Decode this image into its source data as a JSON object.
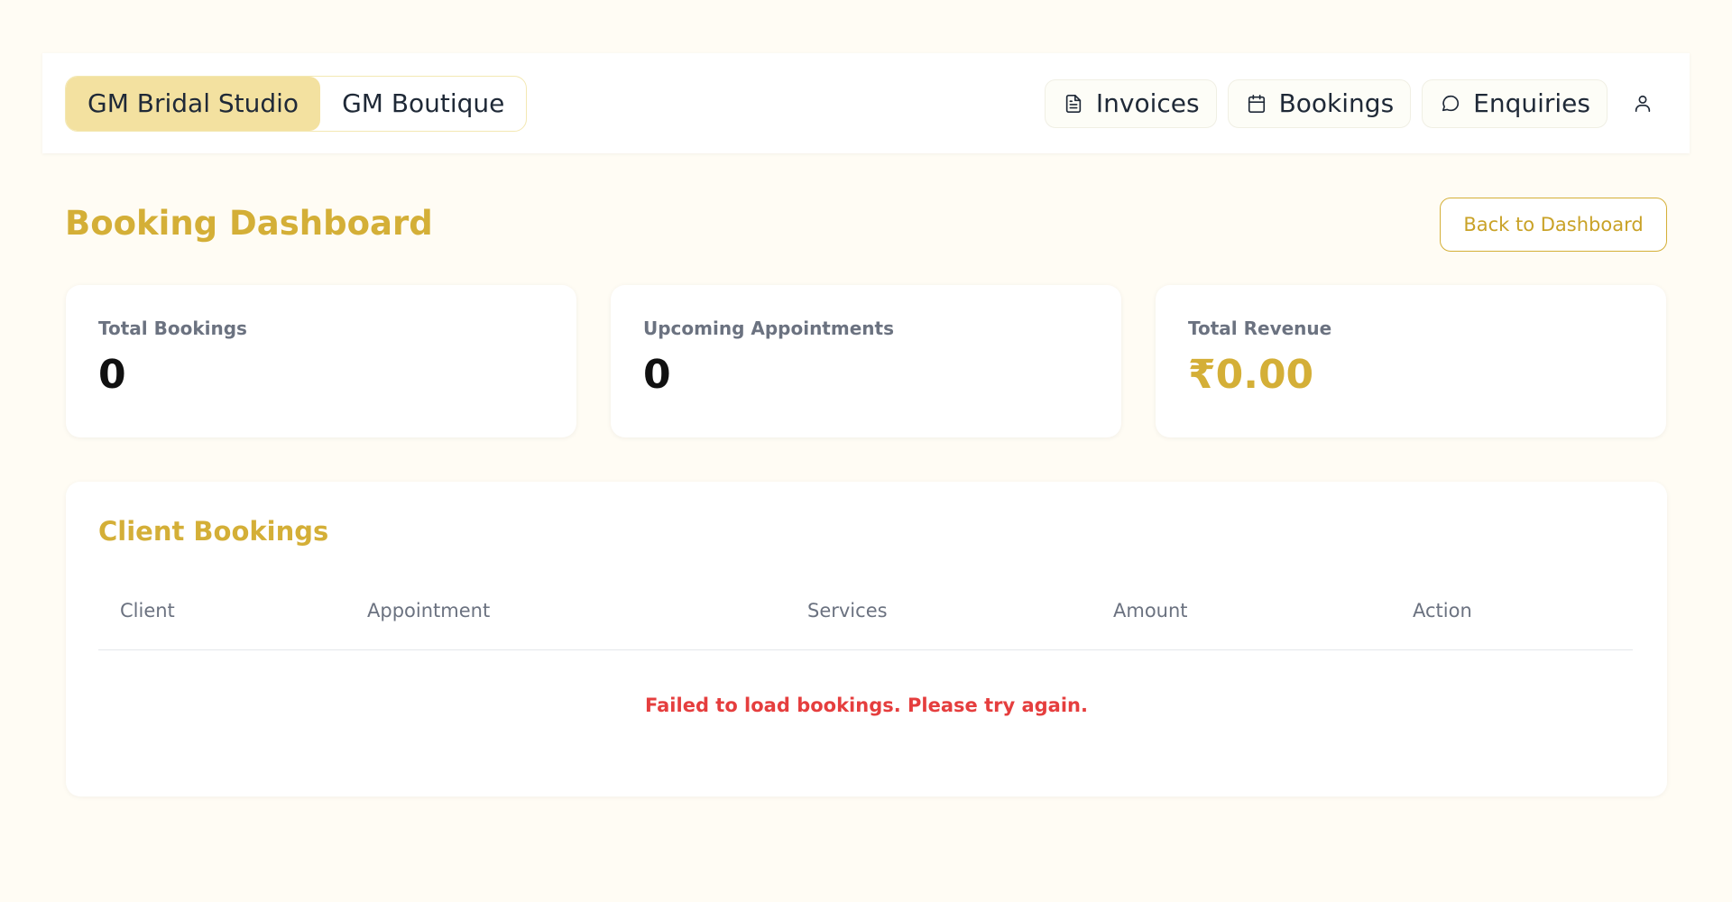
{
  "nav": {
    "studios": [
      "GM Bridal Studio",
      "GM Boutique"
    ],
    "links": [
      {
        "label": "Invoices",
        "icon": "document-icon"
      },
      {
        "label": "Bookings",
        "icon": "calendar-icon"
      },
      {
        "label": "Enquiries",
        "icon": "chat-bubble-icon"
      }
    ],
    "user_icon": "user-icon"
  },
  "page": {
    "title": "Booking Dashboard",
    "back_label": "Back to Dashboard"
  },
  "stats": [
    {
      "label": "Total Bookings",
      "value": "0"
    },
    {
      "label": "Upcoming Appointments",
      "value": "0"
    },
    {
      "label": "Total Revenue",
      "value": "₹0.00"
    }
  ],
  "bookings": {
    "title": "Client Bookings",
    "columns": [
      "Client",
      "Appointment",
      "Services",
      "Amount",
      "Action"
    ],
    "error": "Failed to load bookings. Please try again."
  },
  "colors": {
    "accent": "#d4af37",
    "active_tab": "#f3e1a0",
    "background": "#fffcf4",
    "error": "#e53e3e"
  }
}
